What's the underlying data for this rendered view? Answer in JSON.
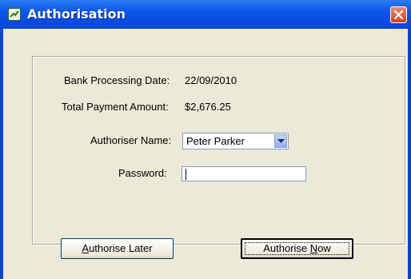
{
  "window": {
    "title": "Authorisation"
  },
  "form": {
    "bank_processing_date_label": "Bank Processing Date:",
    "bank_processing_date_value": "22/09/2010",
    "total_payment_amount_label": "Total Payment Amount:",
    "total_payment_amount_value": "$2,676.25",
    "authoriser_name_label": "Authoriser Name:",
    "authoriser_name_value": "Peter Parker",
    "password_label": "Password:",
    "password_value": "",
    "password_placeholder": ""
  },
  "buttons": {
    "authorise_later": {
      "pre": "",
      "mnemonic": "A",
      "post": "uthorise Later"
    },
    "authorise_now": {
      "pre": "Authorise ",
      "mnemonic": "N",
      "post": "ow"
    }
  },
  "icons": {
    "title": "window-app-icon",
    "close": "close-icon",
    "dropdown": "chevron-down-icon"
  },
  "colors": {
    "titlebar": "#0a56e8",
    "client_bg": "#ece9d8",
    "close_button": "#d4401a"
  }
}
